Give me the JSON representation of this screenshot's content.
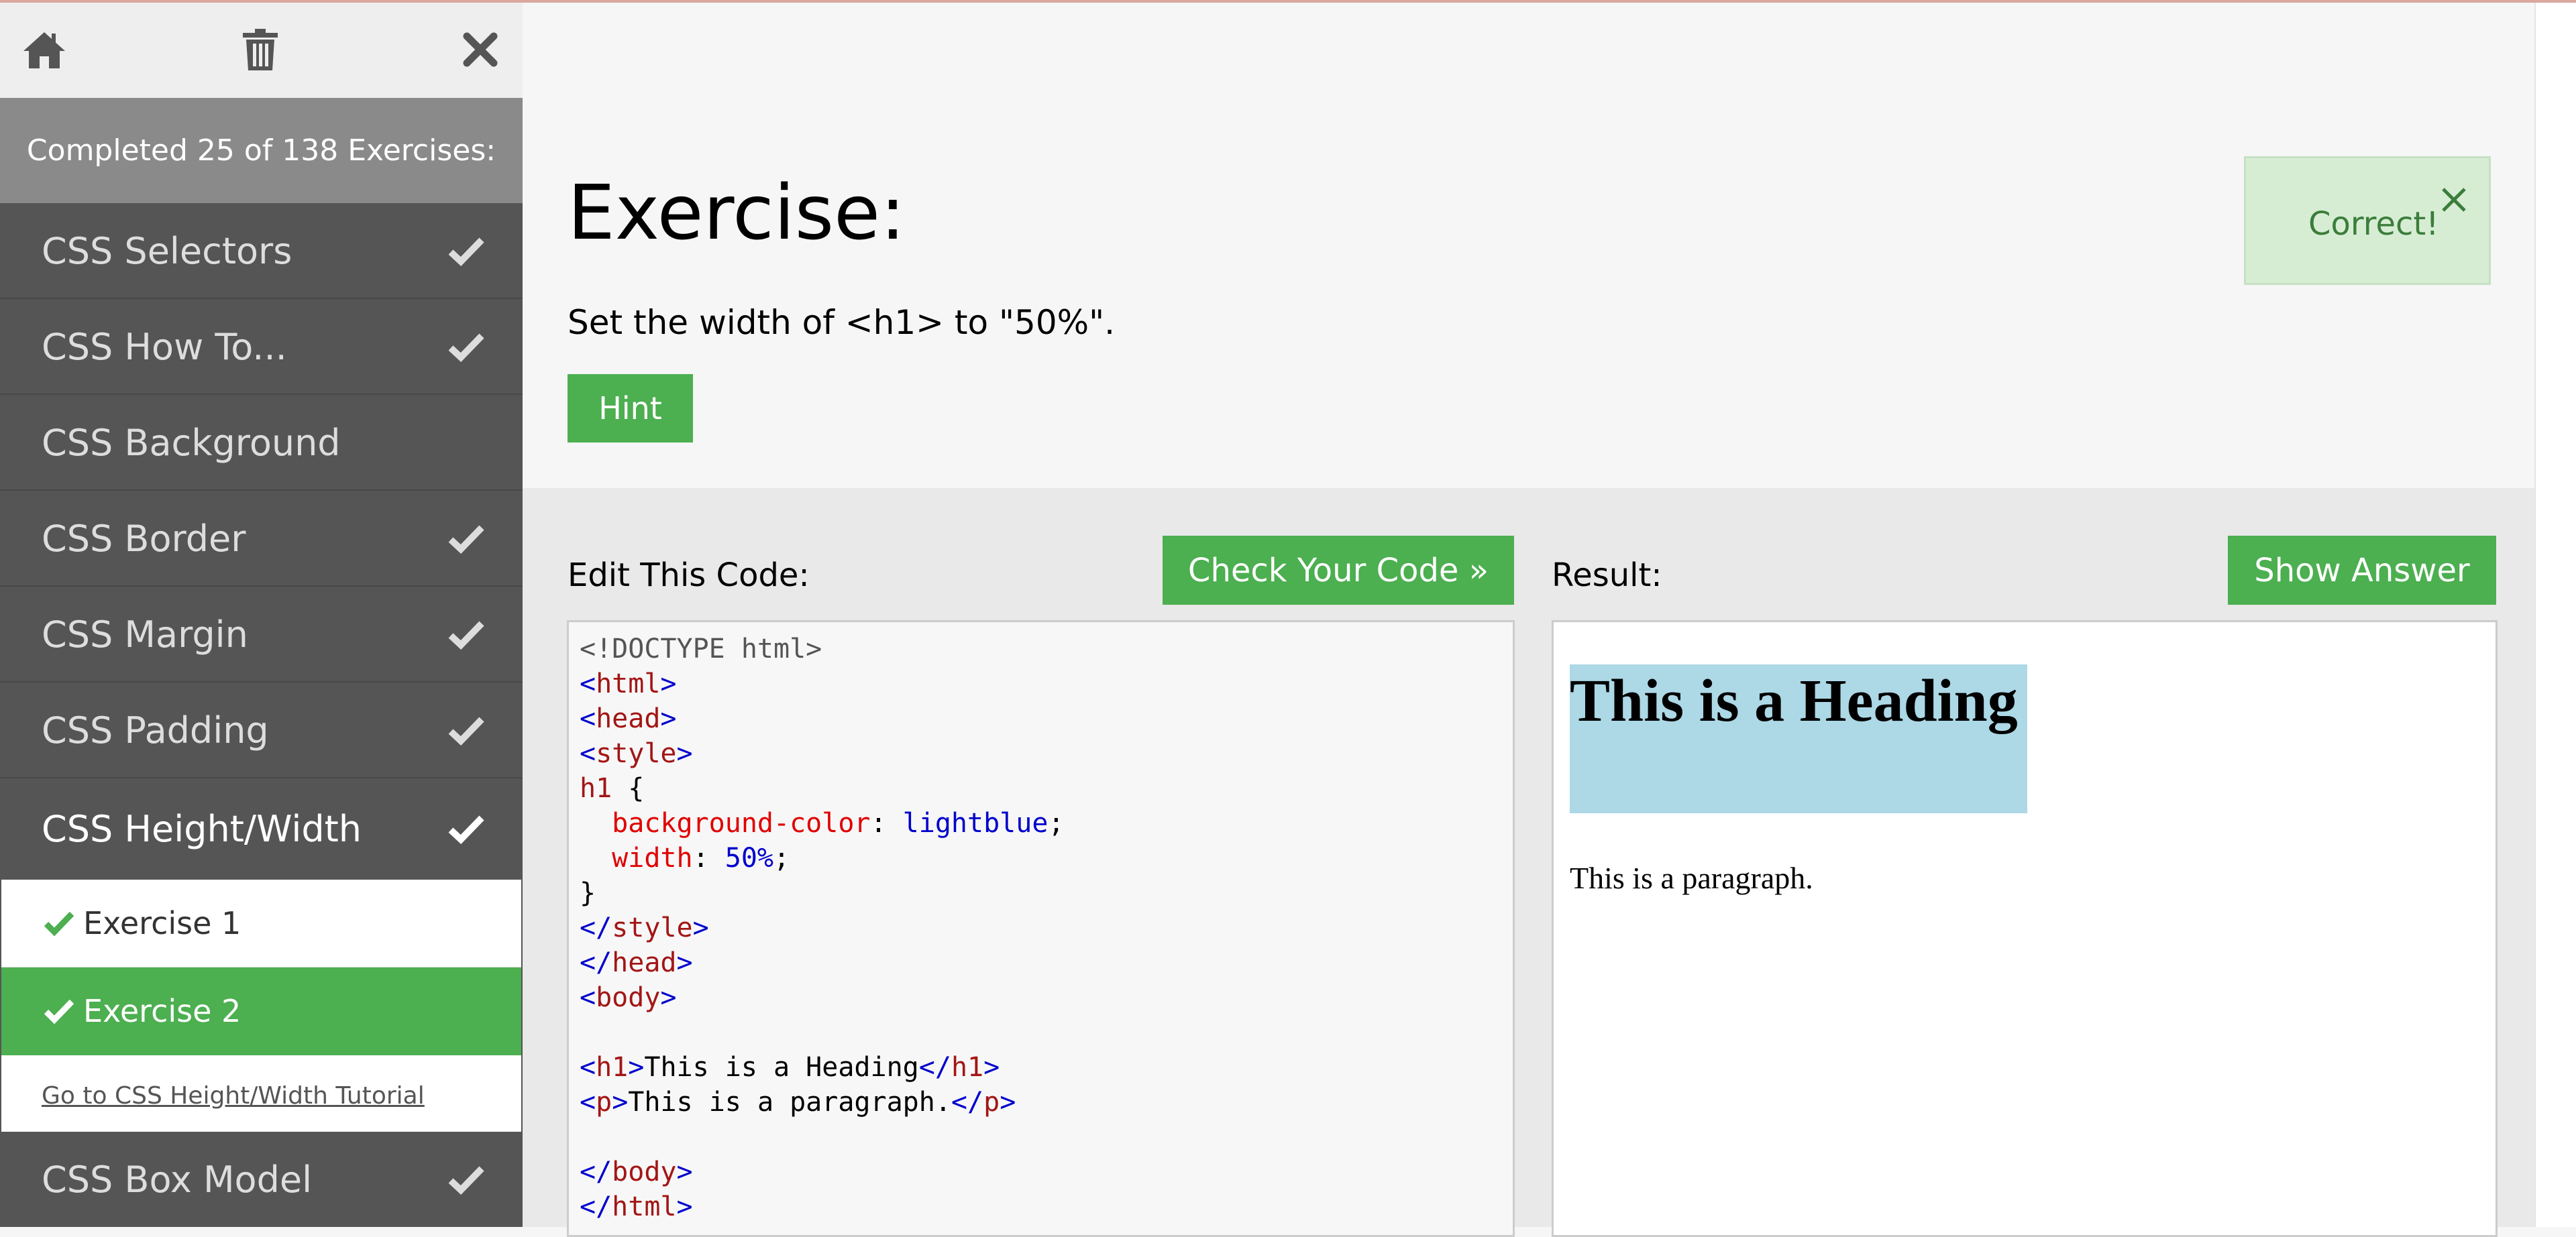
{
  "sidebar": {
    "icons": [
      "home-icon",
      "trash-icon",
      "close-icon"
    ],
    "progress_text": "Completed 25 of 138 Exercises:",
    "categories": [
      {
        "label": "CSS Selectors",
        "completed": true
      },
      {
        "label": "CSS How To...",
        "completed": true
      },
      {
        "label": "CSS Background",
        "completed": false
      },
      {
        "label": "CSS Border",
        "completed": true
      },
      {
        "label": "CSS Margin",
        "completed": true
      },
      {
        "label": "CSS Padding",
        "completed": true
      },
      {
        "label": "CSS Height/Width",
        "completed": true,
        "active": true
      }
    ],
    "exercises": [
      {
        "label": "Exercise 1",
        "completed": true
      },
      {
        "label": "Exercise 2",
        "completed": true,
        "current": true
      }
    ],
    "tutorial_link": "Go to CSS Height/Width Tutorial",
    "next_category": {
      "label": "CSS Box Model",
      "completed": true
    }
  },
  "exercise": {
    "title": "Exercise:",
    "instruction": "Set the width of <h1> to \"50%\".",
    "hint_label": "Hint"
  },
  "feedback": {
    "text": "Correct!"
  },
  "editor": {
    "label": "Edit This Code:",
    "check_button": "Check Your Code »",
    "code": {
      "doctype": "<!DOCTYPE html>",
      "html": "html",
      "head": "head",
      "style": "style",
      "selector": "h1",
      "open_brace": " {",
      "prop1": "background-color",
      "val1": "lightblue",
      "prop2": "width",
      "val2": "50%",
      "close_brace": "}",
      "body": "body",
      "h1_tag": "h1",
      "h1_text": "This is a Heading",
      "p_tag": "p",
      "p_text": "This is a paragraph."
    }
  },
  "result": {
    "label": "Result:",
    "answer_button": "Show Answer",
    "heading": "This is a Heading",
    "paragraph": "This is a paragraph."
  },
  "colors": {
    "accent": "#4caf50",
    "sidebar": "#555555",
    "highlight": "#add8e6"
  }
}
